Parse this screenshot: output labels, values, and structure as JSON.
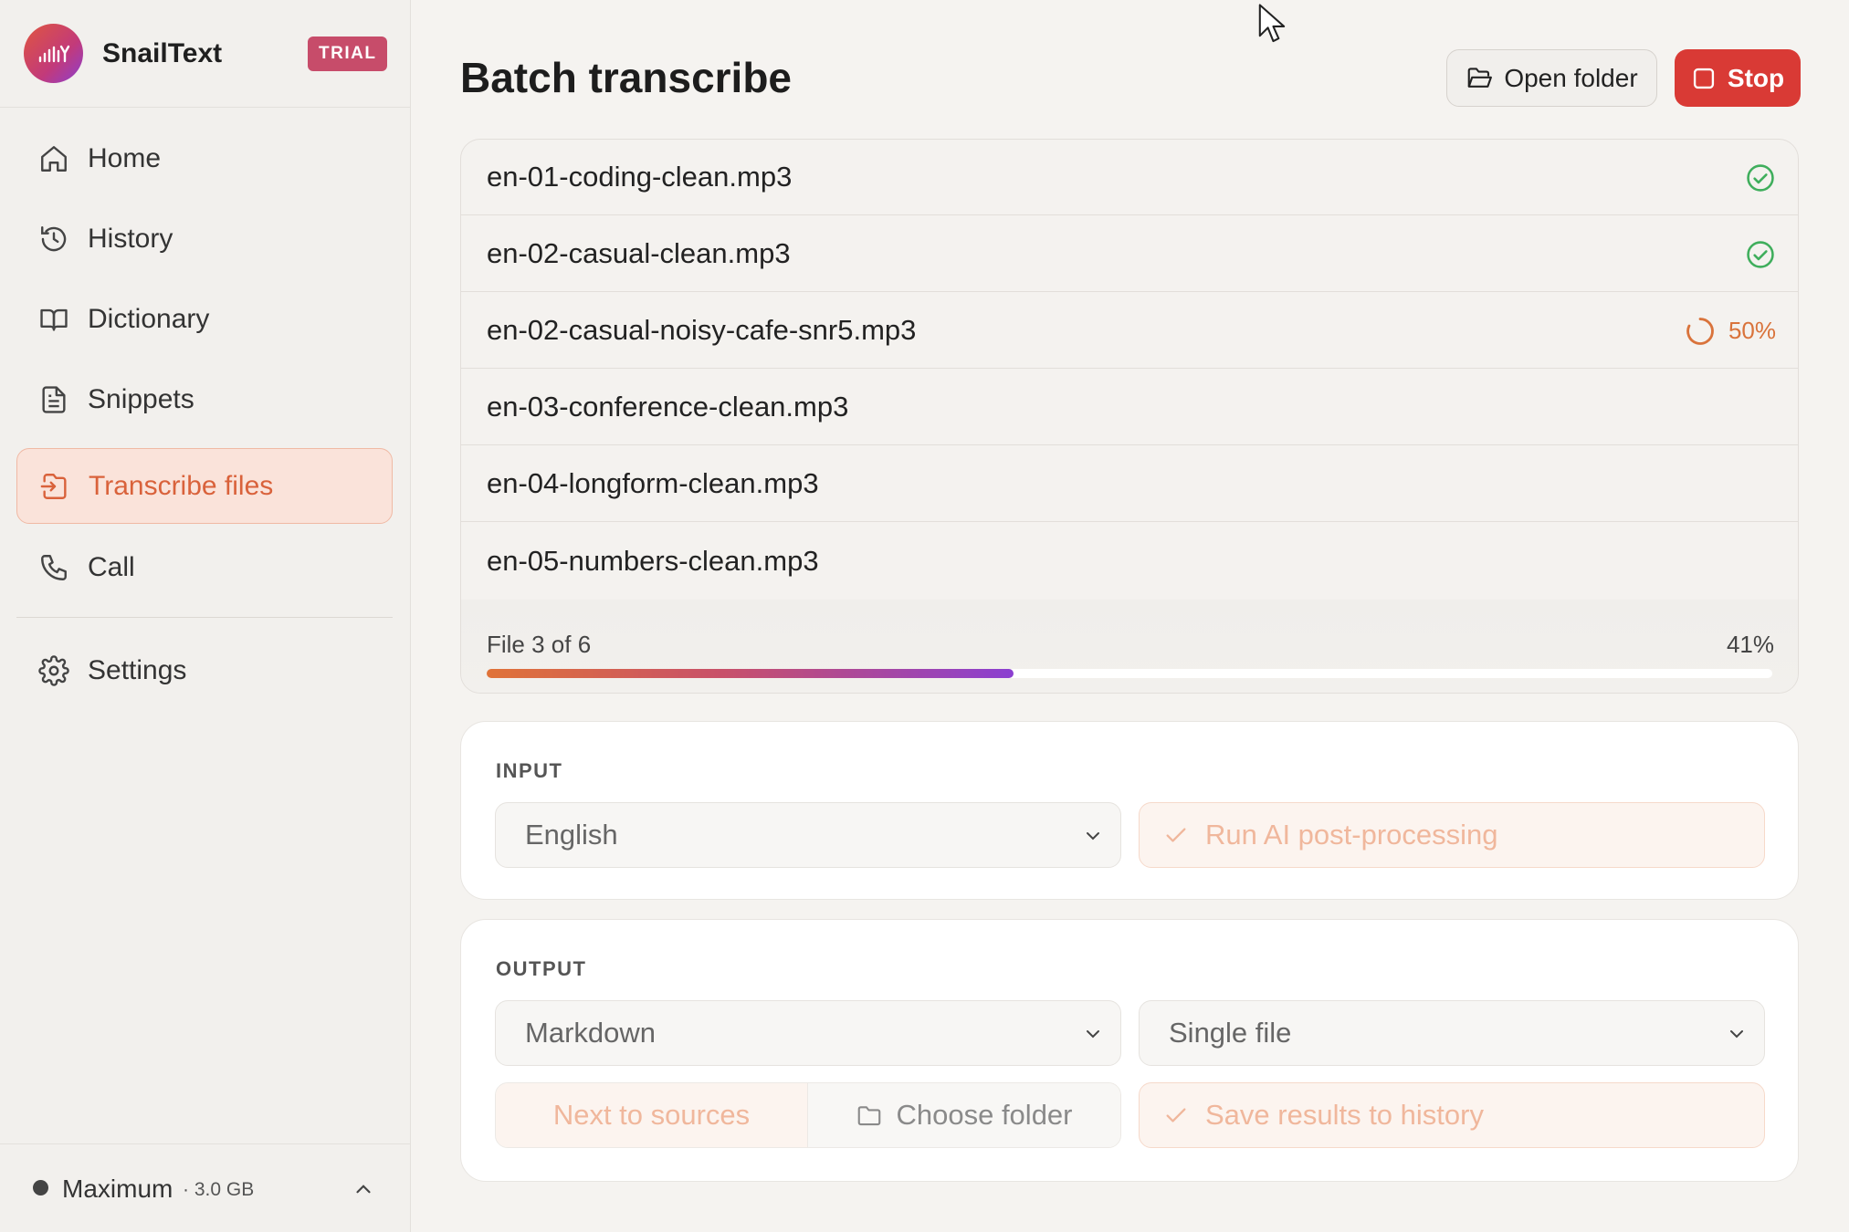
{
  "app": {
    "name": "SnailText",
    "badge": "TRIAL"
  },
  "sidebar": {
    "items": [
      {
        "label": "Home",
        "icon": "home-icon"
      },
      {
        "label": "History",
        "icon": "history-icon"
      },
      {
        "label": "Dictionary",
        "icon": "book-icon"
      },
      {
        "label": "Snippets",
        "icon": "document-icon"
      },
      {
        "label": "Transcribe files",
        "icon": "file-import-icon",
        "active": true
      },
      {
        "label": "Call",
        "icon": "phone-icon"
      },
      {
        "label": "Settings",
        "icon": "gear-icon"
      }
    ],
    "footer": {
      "label": "Maximum",
      "size": "· 3.0 GB"
    }
  },
  "header": {
    "title": "Batch transcribe",
    "open_folder_label": "Open folder",
    "stop_label": "Stop"
  },
  "files": [
    {
      "name": "en-01-coding-clean.mp3",
      "status": "done"
    },
    {
      "name": "en-02-casual-clean.mp3",
      "status": "done"
    },
    {
      "name": "en-02-casual-noisy-cafe-snr5.mp3",
      "status": "processing",
      "percent": "50%"
    },
    {
      "name": "en-03-conference-clean.mp3",
      "status": "pending"
    },
    {
      "name": "en-04-longform-clean.mp3",
      "status": "pending"
    },
    {
      "name": "en-05-numbers-clean.mp3",
      "status": "pending"
    }
  ],
  "progress": {
    "label": "File 3 of 6",
    "percent_text": "41%",
    "fraction": 0.41
  },
  "input": {
    "title": "INPUT",
    "language": "English",
    "ai_postprocessing_label": "Run AI post-processing"
  },
  "output": {
    "title": "OUTPUT",
    "format": "Markdown",
    "mode": "Single file",
    "location_option_a": "Next to sources",
    "location_option_b": "Choose folder",
    "save_history_label": "Save results to history"
  },
  "colors": {
    "accent": "#d9623b",
    "stop": "#d93a35",
    "done": "#3fae5c",
    "processing": "#d9733b",
    "badge": "#c74c6a"
  }
}
